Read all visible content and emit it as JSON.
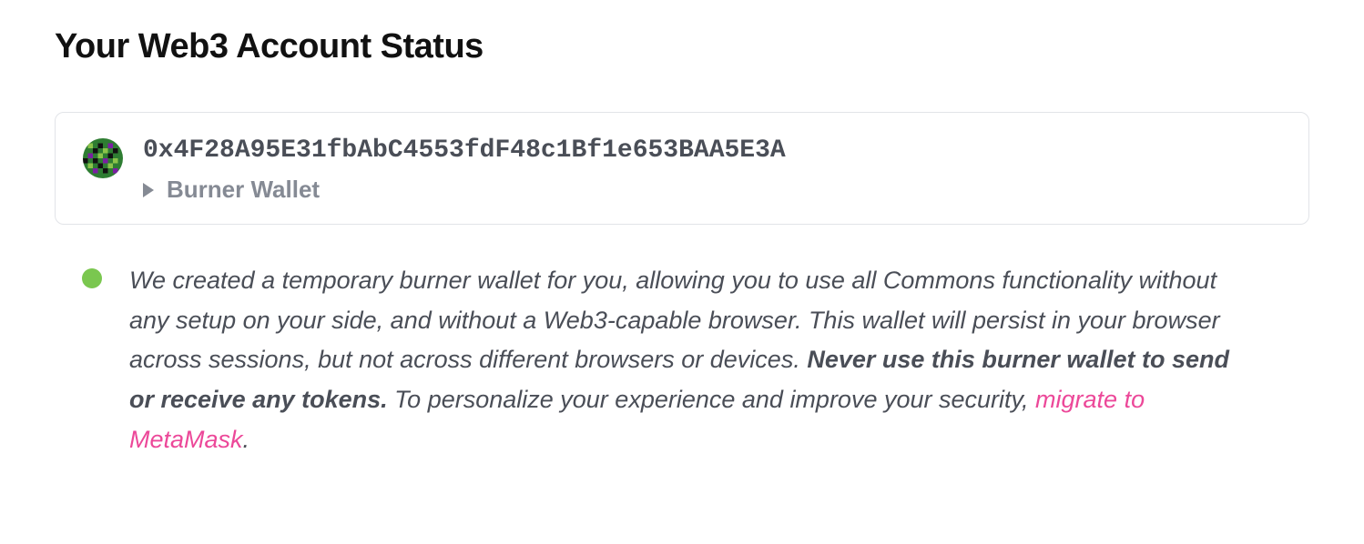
{
  "title": "Your Web3 Account Status",
  "wallet": {
    "address": "0x4F28A95E31fbAbC4553fdF48c1Bf1e653BAA5E3A",
    "type_label": "Burner Wallet"
  },
  "status": {
    "dot_color": "#7ac74f",
    "text_before_bold": "We created a temporary burner wallet for you, allowing you to use all Commons functionality without any setup on your side, and without a Web3-capable browser. This wallet will persist in your browser across sessions, but not across different browsers or devices. ",
    "bold_text": "Never use this burner wallet to send or receive any tokens.",
    "text_after_bold": " To personalize your experience and improve your security, ",
    "link_text": "migrate to MetaMask",
    "text_after_link": "."
  }
}
